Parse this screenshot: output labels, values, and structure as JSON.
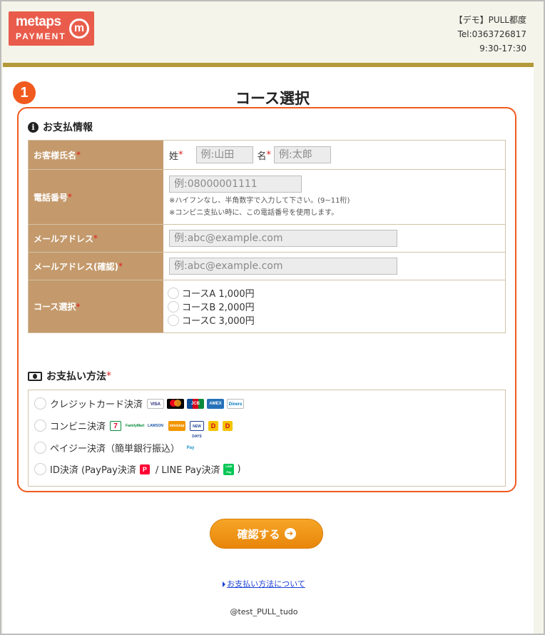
{
  "header": {
    "logo_text_1": "metaps",
    "logo_text_2": "PAYMENT",
    "logo_mark": "m",
    "shop_name": "【デモ】PULL都度",
    "shop_tel": "Tel:0363726817",
    "shop_hours": "9:30-17:30"
  },
  "step_badge": "1",
  "page_title": "コース選択",
  "info_section": {
    "title": "お支払情報",
    "required_mark": "*",
    "fields": {
      "name": {
        "label": "お客様氏名",
        "last_label": "姓",
        "last_placeholder": "例:山田",
        "first_label": "名",
        "first_placeholder": "例:太郎"
      },
      "phone": {
        "label": "電話番号",
        "placeholder": "例:08000001111",
        "note1": "※ハイフンなし、半角数字で入力して下さい。(9~11桁)",
        "note2": "※コンビニ支払い時に、この電話番号を使用します。"
      },
      "email": {
        "label": "メールアドレス",
        "placeholder": "例:abc@example.com"
      },
      "email_confirm": {
        "label": "メールアドレス(確認)",
        "placeholder": "例:abc@example.com"
      },
      "course": {
        "label": "コース選択",
        "options": [
          "コースA 1,000円",
          "コースB 2,000円",
          "コースC 3,000円"
        ]
      }
    }
  },
  "payment_section": {
    "title": "お支払い方法",
    "methods": {
      "credit": "クレジットカード決済",
      "convenience": "コンビニ決済",
      "payeasy": "ペイジー決済（簡単銀行振込）",
      "id_prefix": "ID決済 (PayPay決済",
      "id_mid": "/ LINE Pay決済",
      "id_suffix": ")"
    },
    "card_brands": [
      "VISA",
      "MC",
      "JCB",
      "AMEX",
      "Diners"
    ],
    "stores": [
      "7",
      "FamilyMart",
      "LAWSON",
      "ministop",
      "NEW DAYS",
      "D",
      "D"
    ],
    "payeasy_logo": "Pay",
    "paypay_logo": "P",
    "linepay_logo": "LINE Pay"
  },
  "confirm_button": "確認する",
  "confirm_arrow": "➔",
  "payment_info_link": "お支払い方法について",
  "footer_text": "@test_PULL_tudo",
  "colors": {
    "accent_orange": "#f15a1e",
    "label_bg": "#c49a6c",
    "gold_bar": "#b3993a",
    "button": "#f09818"
  }
}
